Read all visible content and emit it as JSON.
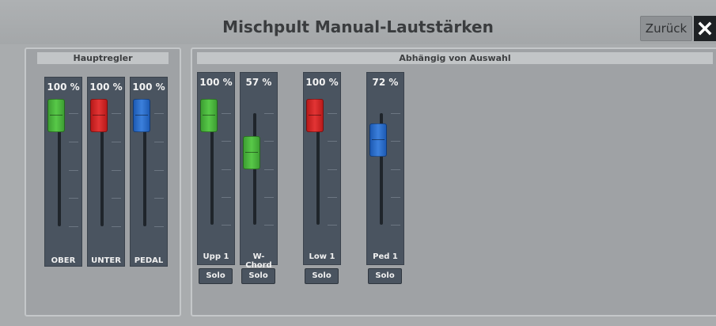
{
  "window": {
    "title": "Mischpult Manual-Lautstärken",
    "back_label": "Zurück",
    "close_icon": "close-icon"
  },
  "main_panel": {
    "title": "Hauptregler",
    "channels": [
      {
        "value": "100 %",
        "level": 1.0,
        "label": "OBER",
        "color": "green"
      },
      {
        "value": "100 %",
        "level": 1.0,
        "label": "UNTER",
        "color": "red"
      },
      {
        "value": "100 %",
        "level": 1.0,
        "label": "PEDAL",
        "color": "blue"
      }
    ]
  },
  "selection_panel": {
    "title": "Abhängig von Auswahl",
    "channels": [
      {
        "value": "100 %",
        "level": 1.0,
        "label": "Upp 1",
        "color": "green",
        "solo_label": "Solo"
      },
      {
        "value": "57 %",
        "level": 0.57,
        "label": "W-Chord",
        "color": "green",
        "solo_label": "Solo"
      },
      {
        "value": "100 %",
        "level": 1.0,
        "label": "Low 1",
        "color": "red",
        "solo_label": "Solo"
      },
      {
        "value": "72 %",
        "level": 0.72,
        "label": "Ped 1",
        "color": "blue",
        "solo_label": "Solo"
      }
    ]
  }
}
